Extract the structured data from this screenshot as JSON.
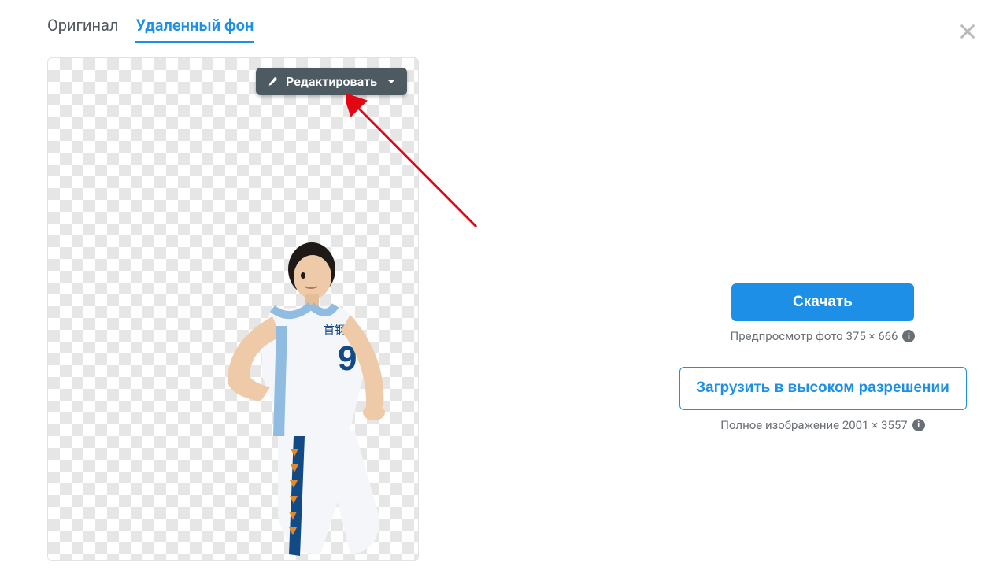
{
  "tabs": {
    "original": "Оригинал",
    "removed_bg": "Удаленный фон"
  },
  "edit_button": "Редактировать",
  "download": {
    "label": "Скачать",
    "caption": "Предпросмотр фото 375 × 666"
  },
  "hires": {
    "label": "Загрузить в высоком разрешении",
    "caption": "Полное изображение 2001 × 3557"
  }
}
